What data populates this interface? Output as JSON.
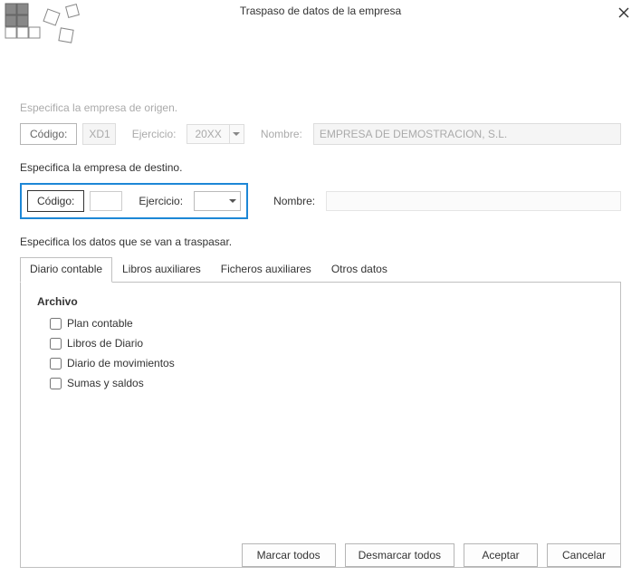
{
  "dialog": {
    "title": "Traspaso de datos de la empresa"
  },
  "origin": {
    "section_label": "Especifica la empresa de origen.",
    "codigo_label": "Código:",
    "codigo_value": "XD1",
    "ejercicio_label": "Ejercicio:",
    "ejercicio_value": "20XX",
    "nombre_label": "Nombre:",
    "nombre_value": "EMPRESA DE DEMOSTRACION, S.L."
  },
  "destination": {
    "section_label": "Especifica la empresa de destino.",
    "codigo_label": "Código:",
    "codigo_value": "",
    "ejercicio_label": "Ejercicio:",
    "ejercicio_value": "",
    "nombre_label": "Nombre:",
    "nombre_value": ""
  },
  "transfer": {
    "section_label": "Especifica los datos que se van a traspasar."
  },
  "tabs": [
    {
      "label": "Diario contable",
      "active": true
    },
    {
      "label": "Libros auxiliares",
      "active": false
    },
    {
      "label": "Ficheros auxiliares",
      "active": false
    },
    {
      "label": "Otros datos",
      "active": false
    }
  ],
  "panel": {
    "group_title": "Archivo",
    "checkboxes": [
      {
        "label": "Plan contable",
        "checked": false
      },
      {
        "label": "Libros de Diario",
        "checked": false
      },
      {
        "label": "Diario de movimientos",
        "checked": false
      },
      {
        "label": "Sumas y saldos",
        "checked": false
      }
    ]
  },
  "footer": {
    "mark_all": "Marcar todos",
    "unmark_all": "Desmarcar todos",
    "accept": "Aceptar",
    "cancel": "Cancelar"
  }
}
